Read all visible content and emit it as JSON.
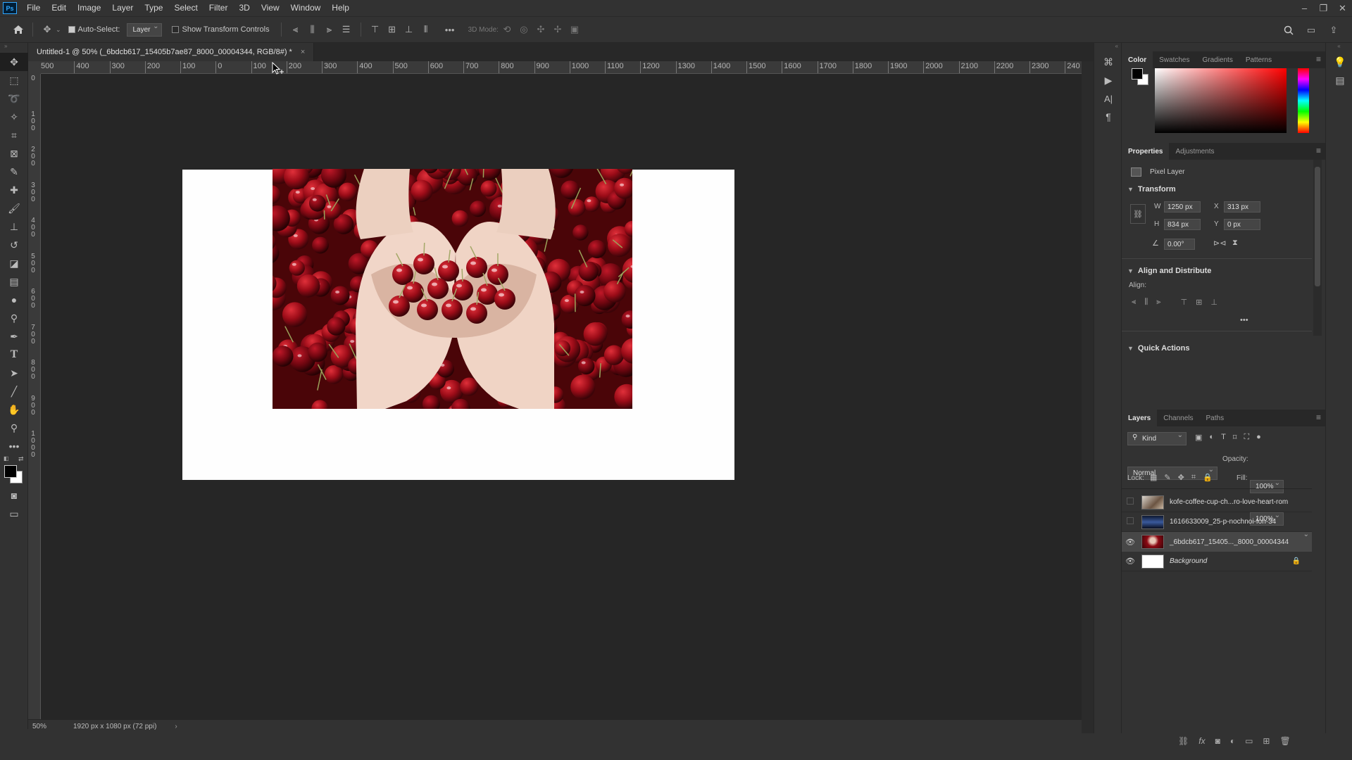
{
  "menubar": {
    "app_badge": "Ps",
    "items": [
      "File",
      "Edit",
      "Image",
      "Layer",
      "Type",
      "Select",
      "Filter",
      "3D",
      "View",
      "Window",
      "Help"
    ]
  },
  "options": {
    "auto_select_label": "Auto-Select:",
    "auto_select_checked": true,
    "auto_select_target": "Layer",
    "transform_controls_label": "Show Transform Controls",
    "more": "•••",
    "mode_3d_label": "3D Mode:"
  },
  "document": {
    "tab_title": "Untitled-1 @ 50% (_6bdcb617_15405b7ae87_8000_00004344, RGB/8#) *",
    "close": "×",
    "zoom": "50%",
    "info": "1920 px x 1080 px (72 ppi)",
    "info_arrow": "›"
  },
  "rulers": {
    "h_labels": [
      "500",
      "400",
      "300",
      "200",
      "100",
      "0",
      "100",
      "200",
      "300",
      "400",
      "500",
      "600",
      "700",
      "800",
      "900",
      "1000",
      "1100",
      "1200",
      "1300",
      "1400",
      "1500",
      "1600",
      "1700",
      "1800",
      "1900",
      "2000",
      "2100",
      "2200",
      "2300",
      "240"
    ],
    "v_labels": [
      "0",
      "1\n0\n0",
      "2\n0\n0",
      "3\n0\n0",
      "4\n0\n0",
      "5\n0\n0",
      "6\n0\n0",
      "7\n0\n0",
      "8\n0\n0",
      "9\n0\n0",
      "1\n0\n0\n0"
    ]
  },
  "color_panel": {
    "tabs": [
      "Color",
      "Swatches",
      "Gradients",
      "Patterns"
    ],
    "fg": "#000000",
    "bg": "#ffffff",
    "hue": "#ff0000"
  },
  "properties": {
    "tabs": [
      "Properties",
      "Adjustments"
    ],
    "layer_type": "Pixel Layer",
    "transform_title": "Transform",
    "w_label": "W",
    "w": "1250 px",
    "h_label": "H",
    "h": "834 px",
    "x_label": "X",
    "x": "313 px",
    "y_label": "Y",
    "y": "0 px",
    "angle": "0.00°",
    "align_title": "Align and Distribute",
    "align_label": "Align:",
    "more": "•••",
    "quick_actions_title": "Quick Actions"
  },
  "layers_panel": {
    "tabs": [
      "Layers",
      "Channels",
      "Paths"
    ],
    "filter_kind": "Kind",
    "blend_mode": "Normal",
    "opacity_label": "Opacity:",
    "opacity": "100%",
    "lock_label": "Lock:",
    "fill_label": "Fill:",
    "fill": "100%",
    "layers": [
      {
        "name": "kofe-coffee-cup-ch...ro-love-heart-rom",
        "visible": false,
        "selected": false
      },
      {
        "name": "1616633009_25-p-nochnoi-fon-34",
        "visible": false,
        "selected": false
      },
      {
        "name": "_6bdcb617_15405..._8000_00004344",
        "visible": true,
        "selected": true
      },
      {
        "name": "Background",
        "visible": true,
        "selected": false,
        "locked": true
      }
    ]
  },
  "colors": {
    "accent": "#31a8ff",
    "canvas_bg": "#262626",
    "chrome": "#323232"
  }
}
